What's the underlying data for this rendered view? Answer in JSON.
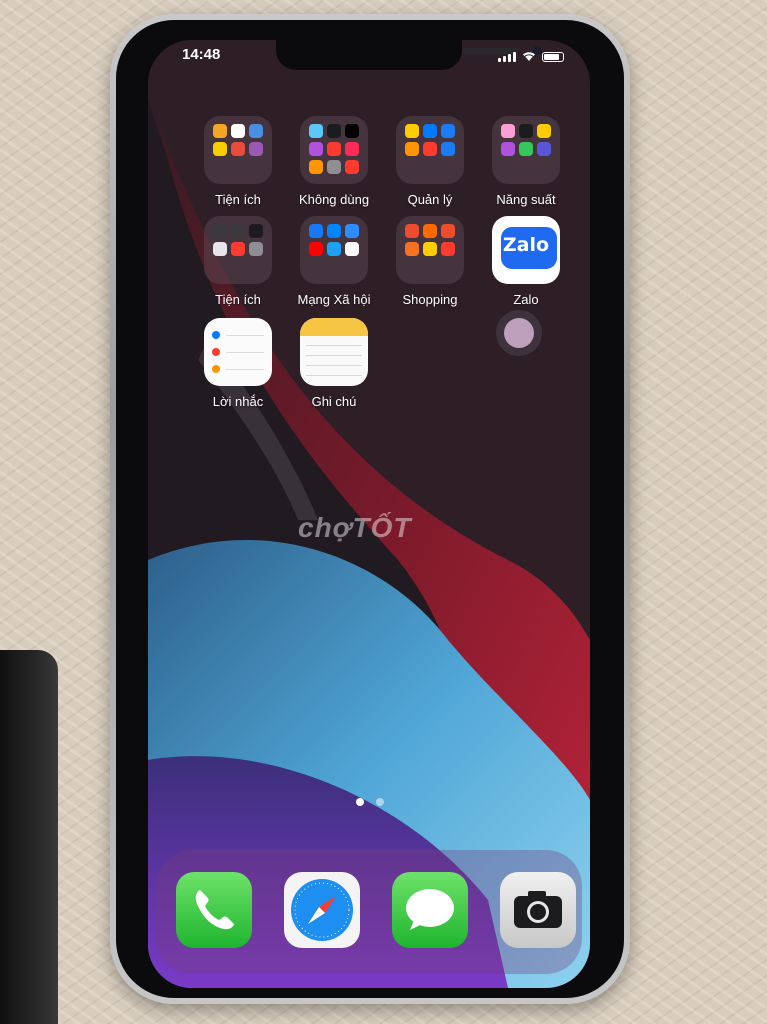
{
  "status_bar": {
    "time": "14:48"
  },
  "home": {
    "apps": [
      {
        "name": "Tiện ích",
        "type": "folder",
        "colors": [
          "#f5a623",
          "#ffffff",
          "#4a90e2",
          "#f5d000",
          "#e74c3c",
          "#9b59b6"
        ]
      },
      {
        "name": "Không dùng",
        "type": "folder",
        "colors": [
          "#5ac8fa",
          "#1c1c1e",
          "#000000",
          "#af52de",
          "#ff3b30",
          "#ff2d55",
          "#ff9500",
          "#8e8e93",
          "#ff3b30"
        ]
      },
      {
        "name": "Quản lý",
        "type": "folder",
        "colors": [
          "#ffcc00",
          "#007aff",
          "#1c7cf4",
          "#ff9500",
          "#ff3b30",
          "#1c7cf4"
        ]
      },
      {
        "name": "Năng suất",
        "type": "folder",
        "colors": [
          "#ff9fd5",
          "#1c1c1e",
          "#ffcc00",
          "#af52de",
          "#34c759",
          "#5856d6"
        ]
      },
      {
        "name": "Tiện ích",
        "type": "folder",
        "colors": [
          "#3a3a3c",
          "#3a3a3c",
          "#1c1c1e",
          "#e5e5ea",
          "#ff3b30",
          "#8e8e93"
        ]
      },
      {
        "name": "Mạng Xã hội",
        "type": "folder",
        "colors": [
          "#1877f2",
          "#0084ff",
          "#2d8cff",
          "#ff0000",
          "#1da1f2",
          "#ffffff"
        ]
      },
      {
        "name": "Shopping",
        "type": "folder",
        "colors": [
          "#ee4d2d",
          "#ff6a00",
          "#ee4d2d",
          "#f57224",
          "#ffcc00",
          "#ff3b30"
        ]
      },
      {
        "name": "Zalo",
        "type": "app",
        "icon_text": "Zalo"
      },
      {
        "name": "Lời nhắc",
        "type": "app"
      },
      {
        "name": "Ghi chú",
        "type": "app"
      }
    ],
    "page_count": 2,
    "current_page": 1
  },
  "watermark": "chợTỐT",
  "dock": [
    {
      "name": "phone"
    },
    {
      "name": "safari"
    },
    {
      "name": "messages"
    },
    {
      "name": "camera"
    }
  ]
}
